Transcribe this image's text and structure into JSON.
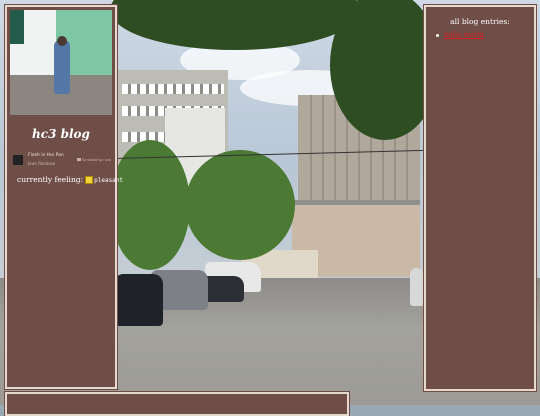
{
  "left_panel": {
    "blog_title": "hc3 blog",
    "now_playing": {
      "track": "Flesh in the Pan",
      "artist": "Jaws Rainbow",
      "status": "Scrobbling now"
    },
    "feeling_label": "currently feeling:",
    "feeling_value": "pleasant",
    "feeling_icon": "smiley-icon"
  },
  "right_panel": {
    "heading": "all blog entries:",
    "entries": [
      {
        "label": "hello world"
      }
    ]
  },
  "colors": {
    "panel_bg": "#6e4e47",
    "panel_border": "#e8d9d0",
    "link": "#d91c1c",
    "text": "#ffffff"
  }
}
